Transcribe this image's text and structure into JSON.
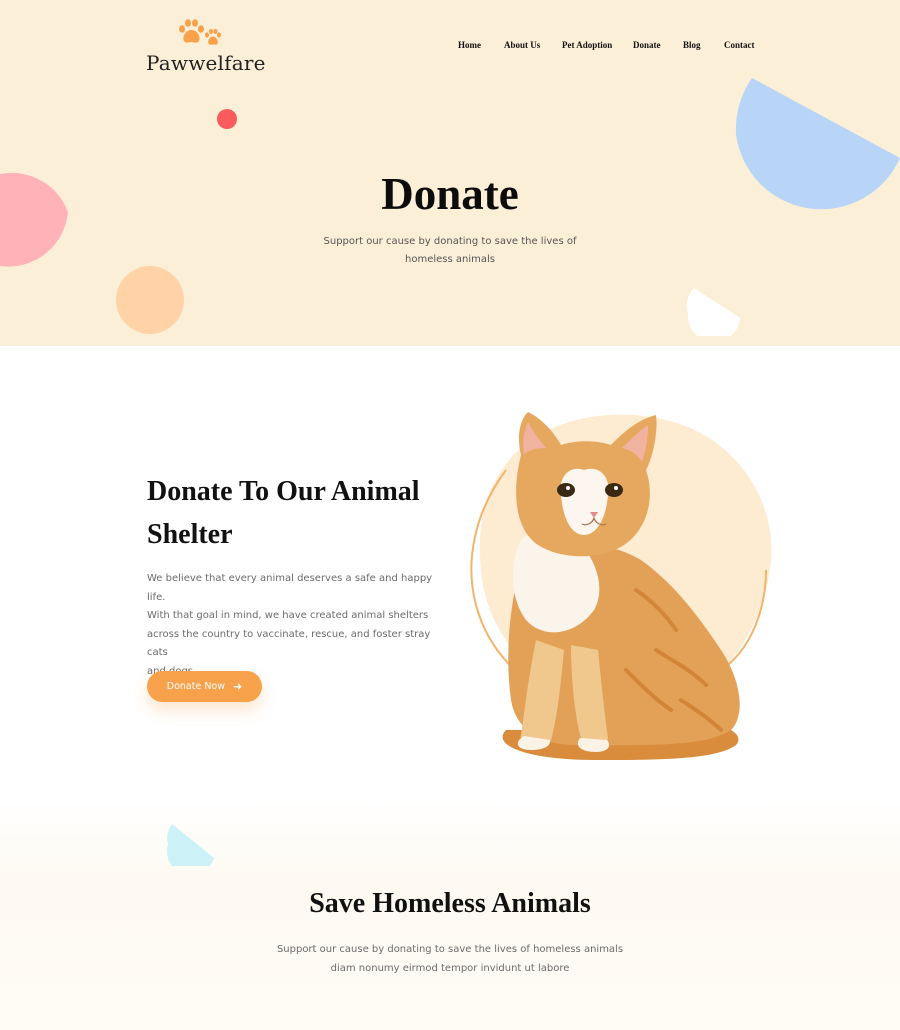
{
  "brand": {
    "name": "Pawwelfare",
    "logo_icon": "paw-icon",
    "accent": "#f7a24a"
  },
  "nav": {
    "items": [
      {
        "label": "Home"
      },
      {
        "label": "About Us"
      },
      {
        "label": "Pet Adoption"
      },
      {
        "label": "Donate"
      },
      {
        "label": "Blog"
      },
      {
        "label": "Contact"
      }
    ]
  },
  "hero": {
    "title": "Donate",
    "subtitle_line1": "Support our cause by donating to save the lives of",
    "subtitle_line2": "homeless animals",
    "background": "#fcefd8"
  },
  "about": {
    "title_line1": "Donate To Our Animal",
    "title_line2": "Shelter",
    "text_line1": "We believe that every animal deserves a safe and happy life.",
    "text_line2": "With that goal in mind, we have created animal shelters",
    "text_line3": "across the country to vaccinate, rescue, and foster stray cats",
    "text_line4": "and dogs.",
    "button_label": "Donate Now",
    "button_icon": "arrow-right-icon"
  },
  "save": {
    "title": "Save Homeless Animals",
    "text_line1": "Support our cause by donating to save the lives of homeless animals",
    "text_line2": "diam nonumy eirmod tempor invidunt ut labore"
  }
}
